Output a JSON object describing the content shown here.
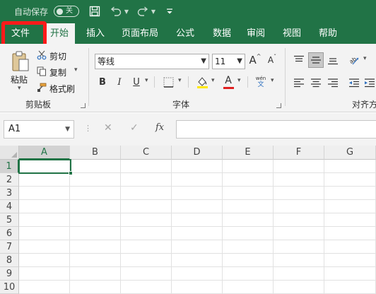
{
  "title_bar": {
    "autosave_label": "自动保存",
    "toggle_label": "关",
    "icons": [
      "save-icon",
      "undo-icon",
      "redo-icon",
      "customize-quick-access-icon"
    ]
  },
  "tabs": [
    {
      "label": "文件"
    },
    {
      "label": "开始",
      "active": true
    },
    {
      "label": "插入"
    },
    {
      "label": "页面布局"
    },
    {
      "label": "公式"
    },
    {
      "label": "数据"
    },
    {
      "label": "审阅"
    },
    {
      "label": "视图"
    },
    {
      "label": "帮助"
    }
  ],
  "clipboard": {
    "paste_label": "粘贴",
    "cut_label": "剪切",
    "copy_label": "复制",
    "format_painter_label": "格式刷",
    "group_label": "剪贴板"
  },
  "font": {
    "font_name": "等线",
    "font_size": "11",
    "grow_label": "A",
    "shrink_label": "A",
    "bold_label": "B",
    "italic_label": "I",
    "underline_label": "U",
    "font_color_label": "A",
    "phonetic_top": "wén",
    "phonetic_bottom": "文",
    "group_label": "字体"
  },
  "alignment": {
    "group_label": "对齐方"
  },
  "formula_bar": {
    "name_box": "A1",
    "cancel_symbol": "✕",
    "enter_symbol": "✓",
    "fx_label": "fx",
    "formula": ""
  },
  "grid": {
    "columns": [
      "A",
      "B",
      "C",
      "D",
      "E",
      "F",
      "G"
    ],
    "rows": [
      "1",
      "2",
      "3",
      "4",
      "5",
      "6",
      "7",
      "8",
      "9",
      "10"
    ],
    "selected_column": "A",
    "selected_row": "1"
  },
  "colors": {
    "brand_green": "#217346",
    "highlight_red": "#ff1a1a",
    "fill_color_yellow": "#ffe800",
    "font_color_red": "#e02020"
  }
}
